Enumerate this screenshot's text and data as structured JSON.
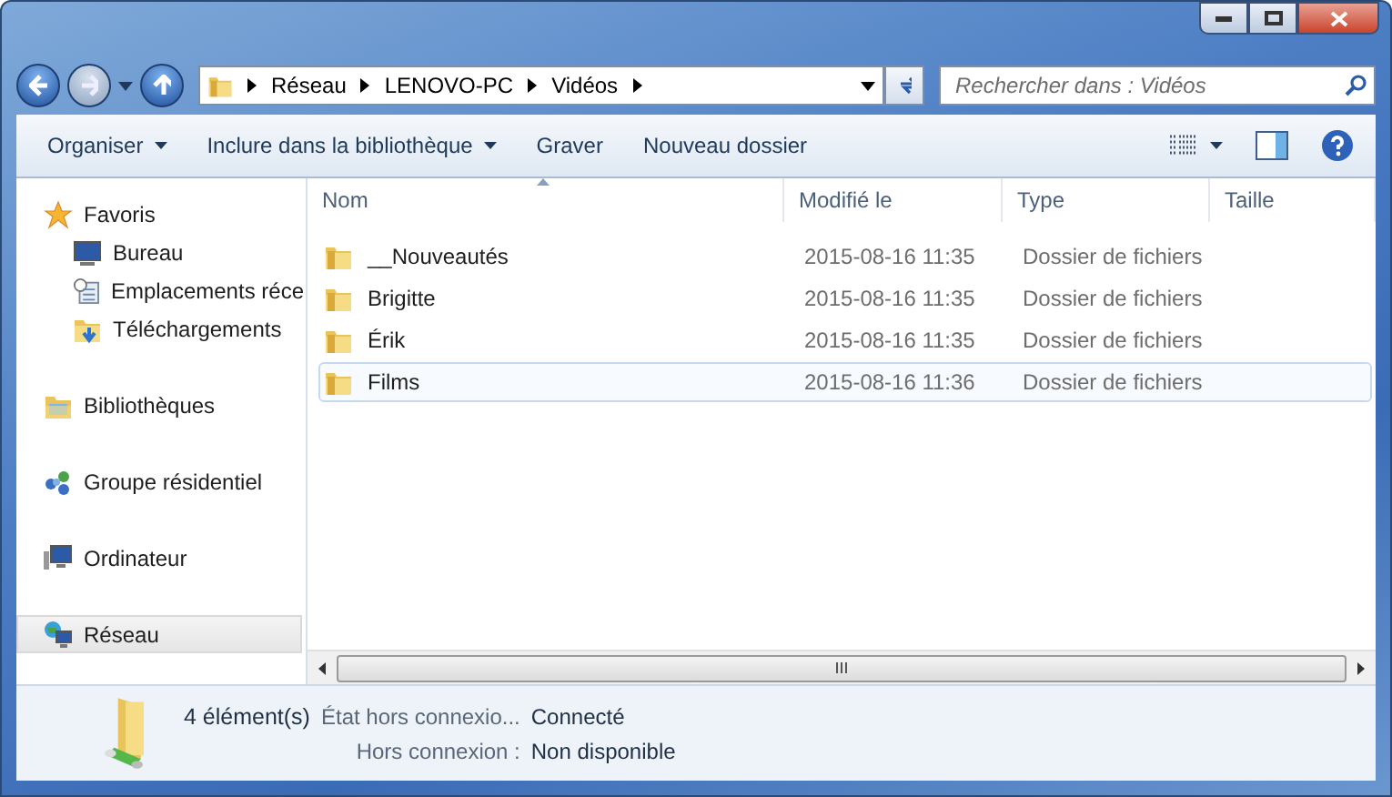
{
  "address": {
    "crumbs": [
      "Réseau",
      "LENOVO-PC",
      "Vidéos"
    ]
  },
  "search": {
    "placeholder": "Rechercher dans : Vidéos"
  },
  "toolbar": {
    "buttons": [
      {
        "label": "Organiser",
        "dropdown": true
      },
      {
        "label": "Inclure dans la bibliothèque",
        "dropdown": true
      },
      {
        "label": "Graver",
        "dropdown": false
      },
      {
        "label": "Nouveau dossier",
        "dropdown": false
      }
    ]
  },
  "sidebar": {
    "items": [
      {
        "label": "Favoris",
        "selected": false,
        "children": [
          {
            "label": "Bureau",
            "selected": false
          },
          {
            "label": "Emplacements réce",
            "selected": false
          },
          {
            "label": "Téléchargements",
            "selected": false
          }
        ]
      },
      {
        "label": "Bibliothèques",
        "selected": false
      },
      {
        "label": "Groupe résidentiel",
        "selected": false
      },
      {
        "label": "Ordinateur",
        "selected": false
      },
      {
        "label": "Réseau",
        "selected": true
      }
    ]
  },
  "table": {
    "columns": [
      "Nom",
      "Modifié le",
      "Type",
      "Taille"
    ],
    "rows": [
      {
        "name": "__Nouveautés",
        "modified": "2015-08-16 11:35",
        "type": "Dossier de fichiers",
        "selected": false
      },
      {
        "name": "Brigitte",
        "modified": "2015-08-16 11:35",
        "type": "Dossier de fichiers",
        "selected": false
      },
      {
        "name": "Érik",
        "modified": "2015-08-16 11:35",
        "type": "Dossier de fichiers",
        "selected": false
      },
      {
        "name": "Films",
        "modified": "2015-08-16 11:36",
        "type": "Dossier de fichiers",
        "selected": true
      }
    ]
  },
  "status_bar": {
    "count": "4 élément(s)",
    "fields": [
      {
        "label": "État hors connexio...",
        "value": "Connecté"
      },
      {
        "label": "Hors connexion :",
        "value": "Non disponible"
      }
    ]
  }
}
